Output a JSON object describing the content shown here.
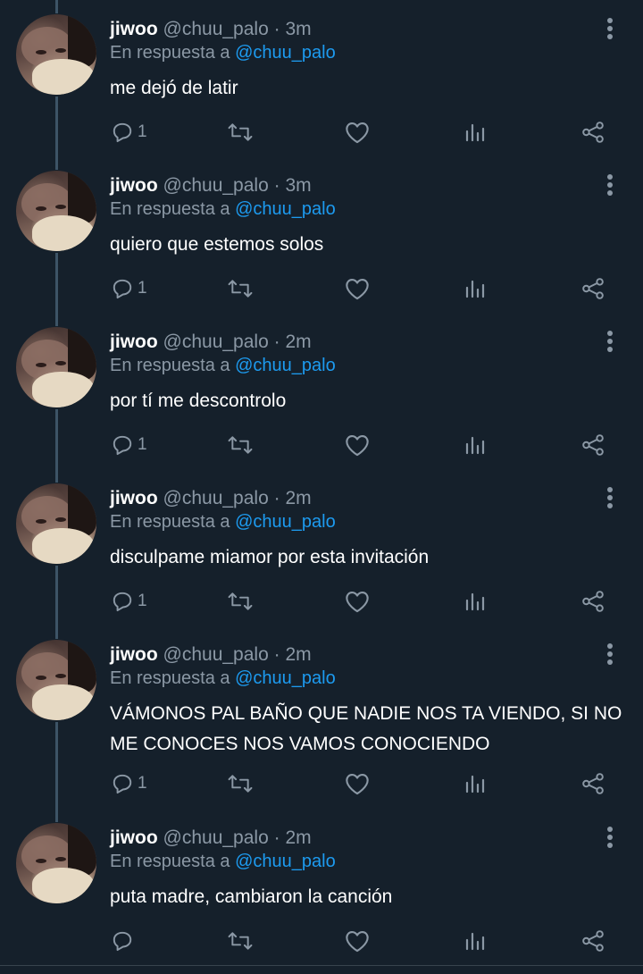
{
  "tweets": [
    {
      "name": "jiwoo",
      "handle": "@chuu_palo",
      "time": "3m",
      "reply_prefix": "En respuesta a",
      "reply_handle": "@chuu_palo",
      "text": "me dejó de latir",
      "replies": "1"
    },
    {
      "name": "jiwoo",
      "handle": "@chuu_palo",
      "time": "3m",
      "reply_prefix": "En respuesta a",
      "reply_handle": "@chuu_palo",
      "text": "quiero que estemos solos",
      "replies": "1"
    },
    {
      "name": "jiwoo",
      "handle": "@chuu_palo",
      "time": "2m",
      "reply_prefix": "En respuesta a",
      "reply_handle": "@chuu_palo",
      "text": "por tí me descontrolo",
      "replies": "1"
    },
    {
      "name": "jiwoo",
      "handle": "@chuu_palo",
      "time": "2m",
      "reply_prefix": "En respuesta a",
      "reply_handle": "@chuu_palo",
      "text": "disculpame miamor por esta invitación",
      "replies": "1"
    },
    {
      "name": "jiwoo",
      "handle": "@chuu_palo",
      "time": "2m",
      "reply_prefix": "En respuesta a",
      "reply_handle": "@chuu_palo",
      "text": "VÁMONOS PAL BAÑO QUE NADIE NOS TA VIENDO, SI NO ME CONOCES NOS VAMOS CONOCIENDO",
      "replies": "1"
    },
    {
      "name": "jiwoo",
      "handle": "@chuu_palo",
      "time": "2m",
      "reply_prefix": "En respuesta a",
      "reply_handle": "@chuu_palo",
      "text": "puta madre, cambiaron la canción",
      "replies": ""
    }
  ],
  "icons": {
    "reply": "reply-icon",
    "retweet": "retweet-icon",
    "like": "heart-icon",
    "views": "analytics-icon",
    "share": "share-icon",
    "more": "more-icon"
  },
  "colors": {
    "background": "#15202b",
    "text": "#ffffff",
    "muted": "#8b98a5",
    "link": "#1d9bf0",
    "thread_line": "#3d5466"
  }
}
